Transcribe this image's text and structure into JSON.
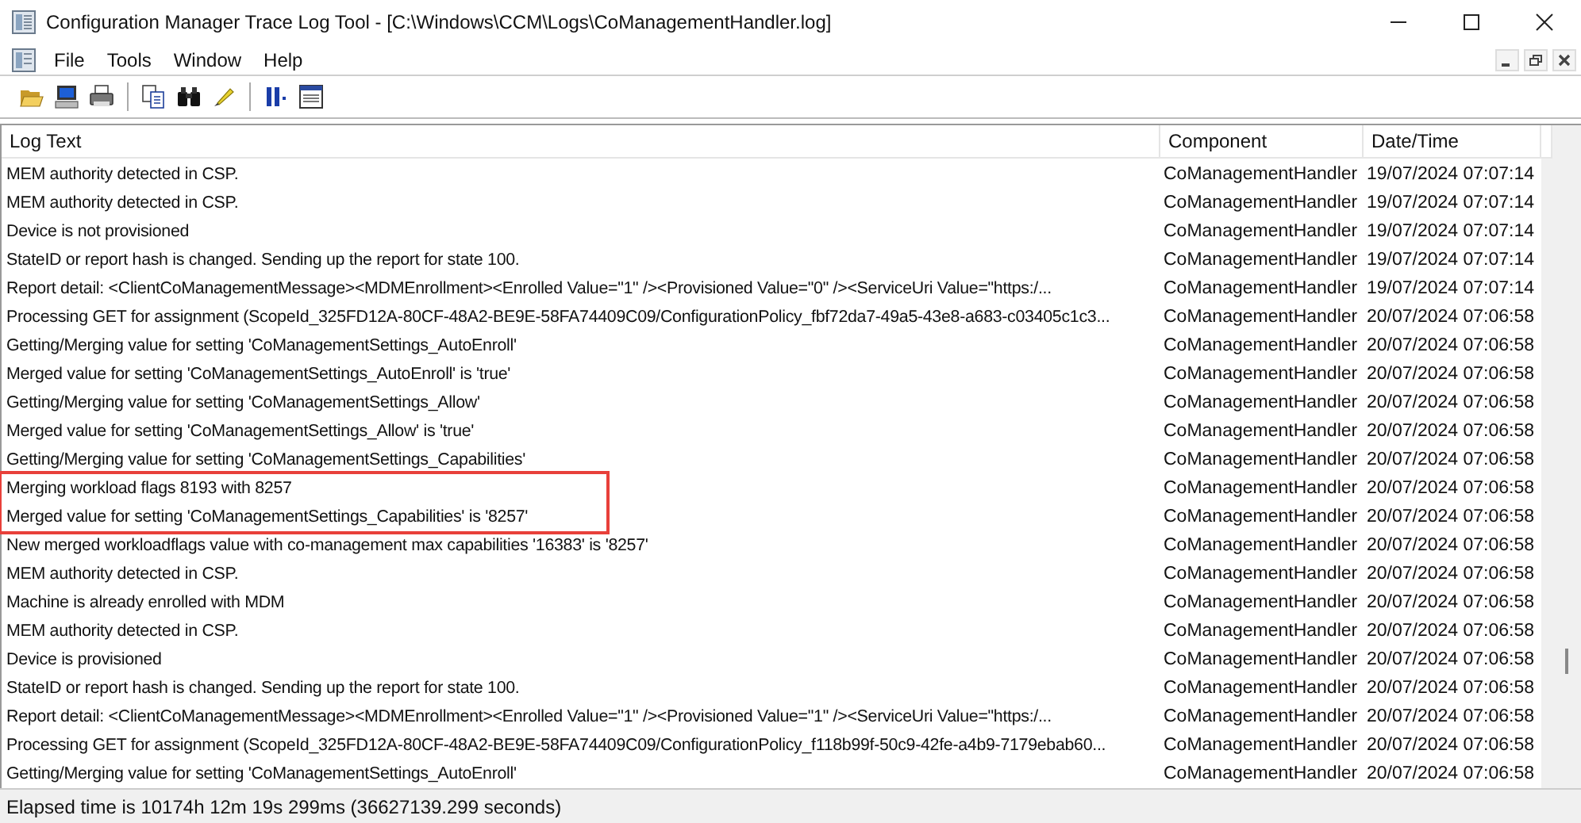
{
  "window": {
    "title": "Configuration Manager Trace Log Tool - [C:\\Windows\\CCM\\Logs\\CoManagementHandler.log]"
  },
  "menu": [
    "File",
    "Tools",
    "Window",
    "Help"
  ],
  "table": {
    "columns": [
      "Log Text",
      "Component",
      "Date/Time"
    ],
    "rows": [
      {
        "text": "MEM authority detected in CSP.",
        "component": "CoManagementHandler",
        "datetime": "19/07/2024 07:07:14",
        "highlighted": false
      },
      {
        "text": "MEM authority detected in CSP.",
        "component": "CoManagementHandler",
        "datetime": "19/07/2024 07:07:14",
        "highlighted": false
      },
      {
        "text": "Device is not provisioned",
        "component": "CoManagementHandler",
        "datetime": "19/07/2024 07:07:14",
        "highlighted": false
      },
      {
        "text": "StateID or report hash is changed. Sending up the report for state 100.",
        "component": "CoManagementHandler",
        "datetime": "19/07/2024 07:07:14",
        "highlighted": false
      },
      {
        "text": "Report detail: <ClientCoManagementMessage><MDMEnrollment><Enrolled Value=\"1\" /><Provisioned Value=\"0\" /><ServiceUri Value=\"https:/...",
        "component": "CoManagementHandler",
        "datetime": "19/07/2024 07:07:14",
        "highlighted": false
      },
      {
        "text": "Processing GET for assignment (ScopeId_325FD12A-80CF-48A2-BE9E-58FA74409C09/ConfigurationPolicy_fbf72da7-49a5-43e8-a683-c03405c1c3...",
        "component": "CoManagementHandler",
        "datetime": "20/07/2024 07:06:58",
        "highlighted": false
      },
      {
        "text": "Getting/Merging value for setting 'CoManagementSettings_AutoEnroll'",
        "component": "CoManagementHandler",
        "datetime": "20/07/2024 07:06:58",
        "highlighted": false
      },
      {
        "text": "Merged value for setting 'CoManagementSettings_AutoEnroll' is 'true'",
        "component": "CoManagementHandler",
        "datetime": "20/07/2024 07:06:58",
        "highlighted": false
      },
      {
        "text": "Getting/Merging value for setting 'CoManagementSettings_Allow'",
        "component": "CoManagementHandler",
        "datetime": "20/07/2024 07:06:58",
        "highlighted": false
      },
      {
        "text": "Merged value for setting 'CoManagementSettings_Allow' is 'true'",
        "component": "CoManagementHandler",
        "datetime": "20/07/2024 07:06:58",
        "highlighted": false
      },
      {
        "text": "Getting/Merging value for setting 'CoManagementSettings_Capabilities'",
        "component": "CoManagementHandler",
        "datetime": "20/07/2024 07:06:58",
        "highlighted": false
      },
      {
        "text": "Merging workload flags 8193 with 8257",
        "component": "CoManagementHandler",
        "datetime": "20/07/2024 07:06:58",
        "highlighted": true
      },
      {
        "text": "Merged value for setting 'CoManagementSettings_Capabilities' is '8257'",
        "component": "CoManagementHandler",
        "datetime": "20/07/2024 07:06:58",
        "highlighted": true
      },
      {
        "text": "New merged workloadflags value with co-management max capabilities '16383' is '8257'",
        "component": "CoManagementHandler",
        "datetime": "20/07/2024 07:06:58",
        "highlighted": false
      },
      {
        "text": "MEM authority detected in CSP.",
        "component": "CoManagementHandler",
        "datetime": "20/07/2024 07:06:58",
        "highlighted": false
      },
      {
        "text": "Machine is already enrolled with MDM",
        "component": "CoManagementHandler",
        "datetime": "20/07/2024 07:06:58",
        "highlighted": false
      },
      {
        "text": "MEM authority detected in CSP.",
        "component": "CoManagementHandler",
        "datetime": "20/07/2024 07:06:58",
        "highlighted": false
      },
      {
        "text": "Device is provisioned",
        "component": "CoManagementHandler",
        "datetime": "20/07/2024 07:06:58",
        "highlighted": false
      },
      {
        "text": "StateID or report hash is changed. Sending up the report for state 100.",
        "component": "CoManagementHandler",
        "datetime": "20/07/2024 07:06:58",
        "highlighted": false
      },
      {
        "text": "Report detail: <ClientCoManagementMessage><MDMEnrollment><Enrolled Value=\"1\" /><Provisioned Value=\"1\" /><ServiceUri Value=\"https:/...",
        "component": "CoManagementHandler",
        "datetime": "20/07/2024 07:06:58",
        "highlighted": false
      },
      {
        "text": "Processing GET for assignment (ScopeId_325FD12A-80CF-48A2-BE9E-58FA74409C09/ConfigurationPolicy_f118b99f-50c9-42fe-a4b9-7179ebab60...",
        "component": "CoManagementHandler",
        "datetime": "20/07/2024 07:06:58",
        "highlighted": false
      },
      {
        "text": "Getting/Merging value for setting 'CoManagementSettings_AutoEnroll'",
        "component": "CoManagementHandler",
        "datetime": "20/07/2024 07:06:58",
        "highlighted": false
      }
    ]
  },
  "status_bar": "Elapsed time is 10174h 12m 19s 299ms (36627139.299 seconds)"
}
